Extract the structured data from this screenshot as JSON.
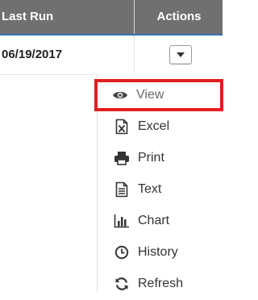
{
  "table": {
    "headers": {
      "last_run": "Last Run",
      "actions": "Actions"
    },
    "rows": [
      {
        "last_run": "06/19/2017"
      }
    ]
  },
  "colors": {
    "header_bg": "#707070",
    "highlight": "#e01e1e"
  },
  "actions_menu": {
    "items": [
      {
        "label": "View",
        "icon": "eye-icon",
        "highlighted": true
      },
      {
        "label": "Excel",
        "icon": "excel-file-icon"
      },
      {
        "label": "Print",
        "icon": "printer-icon"
      },
      {
        "label": "Text",
        "icon": "text-file-icon"
      },
      {
        "label": "Chart",
        "icon": "bar-chart-icon"
      },
      {
        "label": "History",
        "icon": "clock-icon"
      },
      {
        "label": "Refresh",
        "icon": "refresh-icon"
      }
    ]
  }
}
